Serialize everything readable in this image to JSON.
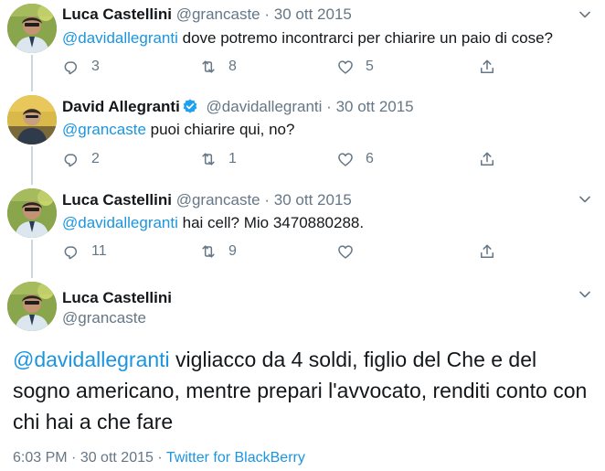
{
  "tweets": [
    {
      "name": "Luca Castellini",
      "handle": "@grancaste",
      "sep": "·",
      "date": "30 ott 2015",
      "mention": "@davidallegranti",
      "text": " dove potremo incontrarci per chiarire un paio di cose?",
      "reply_count": "3",
      "retweet_count": "8",
      "like_count": "5"
    },
    {
      "name": "David Allegranti",
      "handle": "@davidallegranti",
      "sep": "·",
      "date": "30 ott 2015",
      "mention": "@grancaste",
      "text": " puoi chiarire qui, no?",
      "reply_count": "2",
      "retweet_count": "1",
      "like_count": "6"
    },
    {
      "name": "Luca Castellini",
      "handle": "@grancaste",
      "sep": "·",
      "date": "30 ott 2015",
      "mention": "@davidallegranti",
      "text": " hai cell? Mio 3470880288.",
      "reply_count": "11",
      "retweet_count": "9",
      "like_count": ""
    }
  ],
  "main": {
    "name": "Luca Castellini",
    "handle": "@grancaste",
    "mention": "@davidallegranti",
    "text": " vigliacco da 4 soldi, figlio del Che e del sogno americano, mentre prepari l'avvocato, renditi conto con chi hai a che fare",
    "time": "6:03 PM",
    "sep1": " · ",
    "date": "30 ott 2015",
    "sep2": " · ",
    "source": "Twitter for BlackBerry"
  },
  "icons": {
    "reply": "reply-icon",
    "retweet": "retweet-icon",
    "like": "heart-icon",
    "share": "share-icon",
    "caret": "chevron-down-icon",
    "verified": "verified-badge-icon"
  },
  "colors": {
    "accent": "#1b95e0",
    "muted": "#657786",
    "text": "#14171a",
    "verified": "#1da1f2"
  }
}
